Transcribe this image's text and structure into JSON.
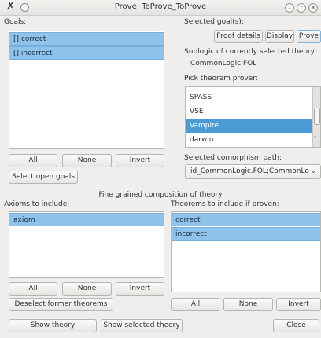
{
  "window": {
    "title": "Prove: ToProve_ToProve"
  },
  "goals": {
    "label": "Goals:",
    "items": [
      "[] correct",
      "[] incorrect"
    ],
    "all_label": "All",
    "none_label": "None",
    "invert_label": "Invert",
    "select_open_label": "Select open goals"
  },
  "selected_goals": {
    "label": "Selected goal(s):",
    "proof_details_label": "Proof details",
    "display_label": "Display",
    "prove_label": "Prove"
  },
  "sublogic": {
    "label": "Sublogic of currently selected theory:",
    "value": "CommonLogic.FOL"
  },
  "prover": {
    "label": "Pick theorem prover:",
    "items": [
      "SPASS",
      "VSE",
      "Vampire",
      "darwin"
    ],
    "selected": "Vampire"
  },
  "comorphism": {
    "label": "Selected comorphism path:",
    "value": "id_CommonLogic.FOL;CommonLo"
  },
  "fine_grained": {
    "label": "Fine grained composition of theory"
  },
  "axioms": {
    "label": "Axioms to include:",
    "items": [
      "axiom"
    ],
    "all_label": "All",
    "none_label": "None",
    "invert_label": "Invert",
    "deselect_label": "Deselect former theorems"
  },
  "theorems": {
    "label": "Theorems to include if proven:",
    "items": [
      "correct",
      "incorrect"
    ],
    "all_label": "All",
    "none_label": "None",
    "invert_label": "Invert"
  },
  "bottom": {
    "show_theory_label": "Show theory",
    "show_selected_label": "Show selected theory",
    "close_label": "Close"
  },
  "colors": {
    "selection": "#8fc3ec",
    "selection_strong": "#4a9ad6",
    "window_bg": "#efeeec"
  }
}
